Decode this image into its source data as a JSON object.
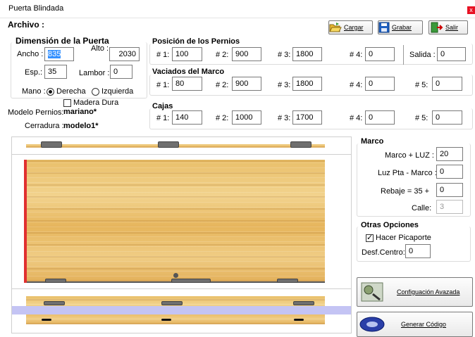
{
  "window": {
    "title": "Puerta Blindada",
    "close": "x"
  },
  "menu": {
    "archivo": "Archivo :"
  },
  "toolbar": {
    "cargar": "Cargar",
    "grabar": "Grabar",
    "salir": "Salir"
  },
  "dimension": {
    "title": "Dimensión de la Puerta",
    "ancho_label": "Ancho :",
    "ancho": "835",
    "alto_label": "Alto :",
    "alto": "2030",
    "esp_label": "Esp.:",
    "esp": "35",
    "lambor_label": "Lambor :",
    "lambor": "0",
    "mano_label": "Mano :",
    "derecha": "Derecha",
    "izquierda": "Izquierda",
    "madera_dura": "Madera Dura"
  },
  "modelo": {
    "pernios_label": "Modelo Pernios:",
    "pernios": "mariano*",
    "cerradura_label": "Cerradura :",
    "cerradura": "modelo1*"
  },
  "pernios": {
    "title": "Posición de los Pernios",
    "l1": "# 1:",
    "v1": "100",
    "l2": "# 2:",
    "v2": "900",
    "l3": "# 3:",
    "v3": "1800",
    "l4": "# 4:",
    "v4": "0",
    "salida_label": "Salida :",
    "salida": "0"
  },
  "vaciados": {
    "title": "Vaciados del Marco",
    "l1": "# 1:",
    "v1": "80",
    "l2": "# 2:",
    "v2": "900",
    "l3": "# 3:",
    "v3": "1800",
    "l4": "# 4:",
    "v4": "0",
    "l5": "# 5:",
    "v5": "0"
  },
  "cajas": {
    "title": "Cajas",
    "l1": "# 1:",
    "v1": "140",
    "l2": "# 2:",
    "v2": "1000",
    "l3": "# 3:",
    "v3": "1700",
    "l4": "# 4:",
    "v4": "0",
    "l5": "# 5:",
    "v5": "0"
  },
  "marco": {
    "title": "Marco",
    "marco_luz_label": "Marco + LUZ :",
    "marco_luz": "20",
    "luz_label": "Luz Pta - Marco :",
    "luz": "0",
    "rebaje_label": "Rebaje =  35 +",
    "rebaje": "0",
    "calle_label": "Calle:",
    "calle": "3"
  },
  "otras": {
    "title": "Otras Opciones",
    "picaporte": "Hacer Picaporte",
    "desf_label": "Desf.Centro:",
    "desf": "0"
  },
  "actions": {
    "config": "Configuación Avazada",
    "generar": "Generar Código"
  },
  "colors": {
    "accent_red": "#e03030",
    "lilac_band": "#c4c4f4"
  }
}
